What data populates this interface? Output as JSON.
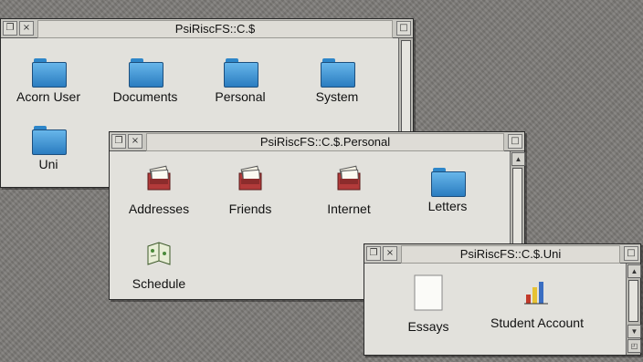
{
  "windows": {
    "root": {
      "title": "PsiRiscFS::C.$",
      "items": [
        {
          "label": "Acorn User",
          "icon": "folder-icon"
        },
        {
          "label": "Documents",
          "icon": "folder-icon"
        },
        {
          "label": "Personal",
          "icon": "folder-icon"
        },
        {
          "label": "System",
          "icon": "folder-icon"
        },
        {
          "label": "Uni",
          "icon": "folder-icon"
        }
      ]
    },
    "personal": {
      "title": "PsiRiscFS::C.$.Personal",
      "items": [
        {
          "label": "Addresses",
          "icon": "card-file-app-icon"
        },
        {
          "label": "Friends",
          "icon": "card-file-app-icon"
        },
        {
          "label": "Internet",
          "icon": "card-file-app-icon"
        },
        {
          "label": "Letters",
          "icon": "folder-icon"
        },
        {
          "label": "Schedule",
          "icon": "schedule-app-icon"
        }
      ]
    },
    "uni": {
      "title": "PsiRiscFS::C.$.Uni",
      "items": [
        {
          "label": "Essays",
          "icon": "document-icon"
        },
        {
          "label": "Student Account",
          "icon": "chart-app-icon"
        }
      ]
    }
  },
  "colors": {
    "folder": "#3a8fd0",
    "desktop": "#7d7b78",
    "window_bg": "#e2e1dc"
  }
}
